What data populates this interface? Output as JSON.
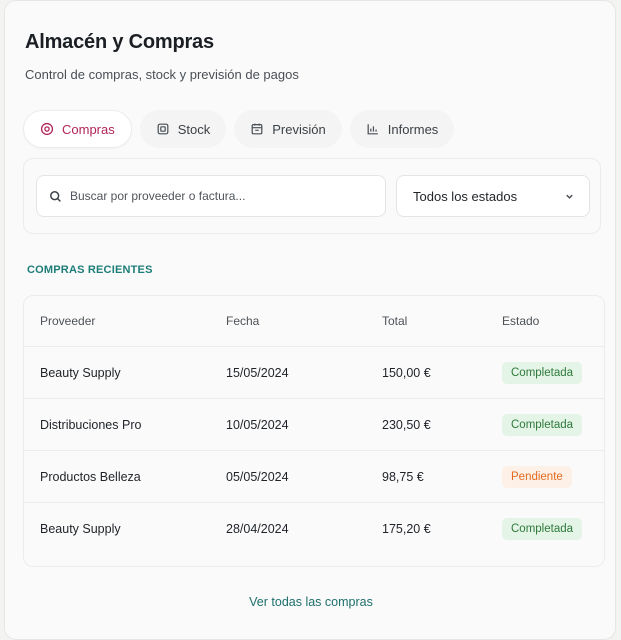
{
  "header": {
    "title": "Almacén y Compras",
    "subtitle": "Control de compras, stock y previsión de pagos"
  },
  "tabs": [
    {
      "label": "Compras",
      "icon": "location-pin-icon",
      "active": true
    },
    {
      "label": "Stock",
      "icon": "box-icon",
      "active": false
    },
    {
      "label": "Previsión",
      "icon": "calendar-icon",
      "active": false
    },
    {
      "label": "Informes",
      "icon": "report-icon",
      "active": false
    }
  ],
  "filters": {
    "search_placeholder": "Buscar por proveeder o factura...",
    "status_selected": "Todos los estados"
  },
  "section_title": "COMPRAS RECIENTES",
  "table": {
    "columns": [
      "Proveeder",
      "Fecha",
      "Total",
      "Estado"
    ],
    "rows": [
      {
        "supplier": "Beauty Supply",
        "date": "15/05/2024",
        "total": "150,00 €",
        "status": "Completada",
        "status_type": "ok"
      },
      {
        "supplier": "Distribuciones Pro",
        "date": "10/05/2024",
        "total": "230,50 €",
        "status": "Completada",
        "status_type": "ok"
      },
      {
        "supplier": "Productos Belleza",
        "date": "05/05/2024",
        "total": "98,75 €",
        "status": "Pendiente",
        "status_type": "pending"
      },
      {
        "supplier": "Beauty Supply",
        "date": "28/04/2024",
        "total": "175,20 €",
        "status": "Completada",
        "status_type": "ok"
      }
    ]
  },
  "footer_link": "Ver todas las compras",
  "colors": {
    "accent": "#b0245a",
    "teal": "#1d7d78",
    "status_ok_bg": "#e4f4e6",
    "status_ok_text": "#2e7a3c",
    "status_pending_bg": "#fdf0e6",
    "status_pending_text": "#e46a1f"
  }
}
